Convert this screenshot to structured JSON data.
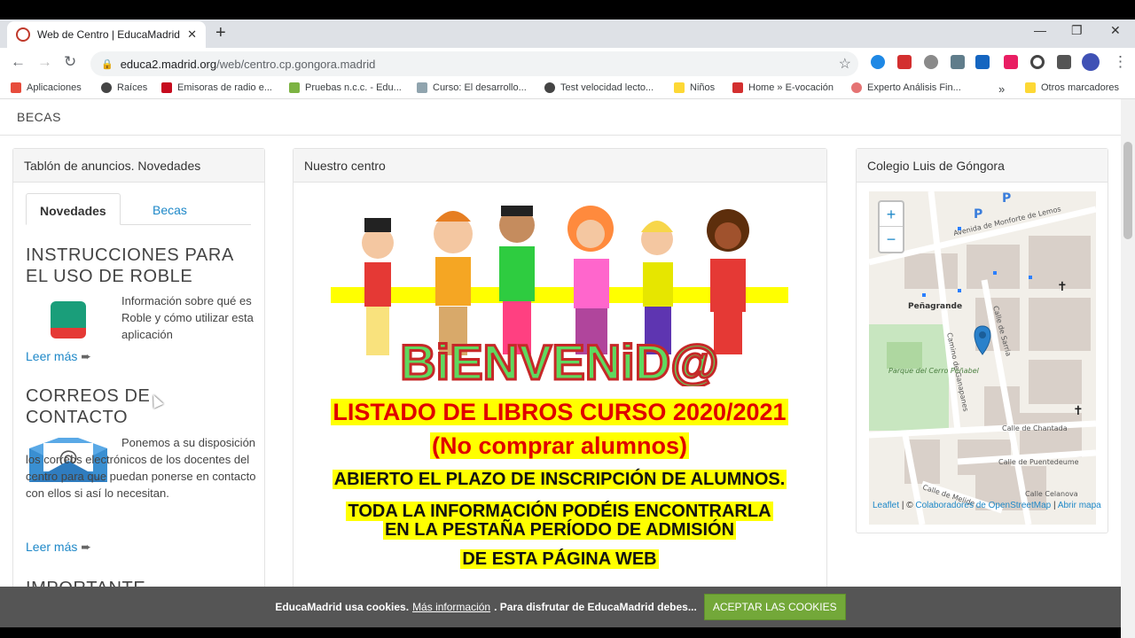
{
  "browser": {
    "tab_title": "Web de Centro | EducaMadrid",
    "url_host": "educa2.madrid.org",
    "url_path": "/web/centro.cp.gongora.madrid",
    "bookmarks": [
      {
        "label": "Aplicaciones",
        "color": "#e74c3c"
      },
      {
        "label": "Raíces",
        "color": "#444444"
      },
      {
        "label": "Emisoras de radio e...",
        "color": "#c60b1e"
      },
      {
        "label": "Pruebas n.c.c. - Edu...",
        "color": "#7cb342"
      },
      {
        "label": "Curso: El desarrollo...",
        "color": "#90a4ae"
      },
      {
        "label": "Test velocidad lecto...",
        "color": "#444444"
      },
      {
        "label": "Niños",
        "color": "#fdd835"
      },
      {
        "label": "Home » E-vocación",
        "color": "#d32f2f"
      },
      {
        "label": "Experto Análisis Fin...",
        "color": "#e57373"
      }
    ],
    "other_bookmarks": "Otros marcadores",
    "overflow": "»"
  },
  "page": {
    "top_menu": "BECAS",
    "left_panel": {
      "title": "Tablón de anuncios. Novedades",
      "tab_active": "Novedades",
      "tab_other": "Becas",
      "item1_title": "INSTRUCCIONES PARA EL USO DE ROBLE",
      "item1_text": "Información sobre qué es Roble y cómo utilizar esta aplicación",
      "item2_title": "CORREOS DE CONTACTO",
      "item2_text": "Ponemos a su disposición los correos electrónicos de los docentes del centro para que puedan ponerse en contacto con ellos si así lo necesitan.",
      "leer_mas": "Leer más",
      "item3_title": "IMPORTANTE"
    },
    "center_panel": {
      "title": "Nuestro centro",
      "welcome": "BiENVENiD@",
      "line1": "LISTADO DE LIBROS CURSO 2020/2021",
      "line2": "(No comprar alumnos)",
      "line3": "ABIERTO EL PLAZO DE INSCRIPCIÓN DE ALUMNOS.",
      "line4": "TODA LA INFORMACIÓN PODÉIS ENCONTRARLA",
      "line5": "EN LA PESTAÑA PERÍODO DE ADMISIÓN",
      "line6": "DE ESTA PÁGINA WEB"
    },
    "right_panel": {
      "title": "Colegio Luis de Góngora",
      "zoom_in": "+",
      "zoom_out": "−",
      "map_labels": [
        {
          "text": "Avenida de Monforte de Lemos"
        },
        {
          "text": "Peñagrande"
        },
        {
          "text": "Calle de Sarria"
        },
        {
          "text": "Camino de Ganapanes"
        },
        {
          "text": "Calle de Chantada"
        },
        {
          "text": "Calle de Puentedeume"
        },
        {
          "text": "Calle Celanova"
        },
        {
          "text": "Calle de Melide"
        },
        {
          "text": "Parque del Cerro Peñabel"
        }
      ],
      "attrib_leaflet": "Leaflet",
      "attrib_sep": "| ©",
      "attrib_osm": "Colaboradores de OpenStreetMap",
      "attrib_open": "Abrir mapa"
    },
    "cookie": {
      "text1": "EducaMadrid usa cookies.",
      "more": "Más información",
      "text2": ". Para disfrutar de EducaMadrid debes...",
      "accept": "ACEPTAR LAS COOKIES"
    }
  }
}
